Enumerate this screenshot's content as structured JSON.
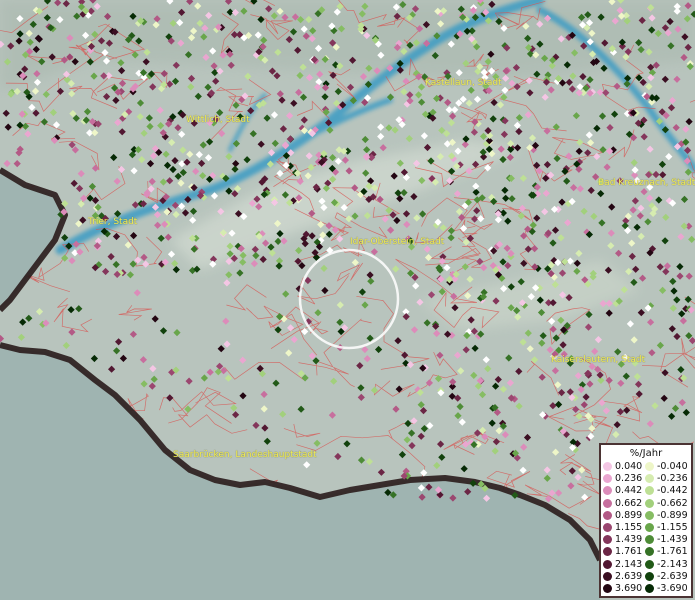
{
  "map": {
    "colors": {
      "background": "#b8c4bd",
      "outside_region": "#9fb4b1",
      "border_line": "#2a1c1c",
      "admin_lines": "#d9524f",
      "river": "#3a9bc4",
      "ridge": "#cfd8cf",
      "highlight_circle": "#ffffff"
    },
    "cities": [
      {
        "id": "kastellaun",
        "label": "Kastellaun, Stadt"
      },
      {
        "id": "wittlich",
        "label": "Wittlich, Stadt"
      },
      {
        "id": "bad-kreuznach",
        "label": "Bad Kreuznach, Stadt"
      },
      {
        "id": "trier",
        "label": "Trier, Stadt"
      },
      {
        "id": "idar-oberstein",
        "label": "Idar-Oberstein, Stadt"
      },
      {
        "id": "kaiserslautern",
        "label": "Kaiserslautern, Stadt"
      },
      {
        "id": "saarbruecken",
        "label": "Saarbrücken, Landeshauptstadt"
      }
    ]
  },
  "legend": {
    "title": "%/Jahr",
    "positive": [
      {
        "label": "0.040",
        "color": "#f4c6e4"
      },
      {
        "label": "0.236",
        "color": "#eaa6d0"
      },
      {
        "label": "0.442",
        "color": "#dc8cba"
      },
      {
        "label": "0.662",
        "color": "#c76f9e"
      },
      {
        "label": "0.899",
        "color": "#b35a86"
      },
      {
        "label": "1.155",
        "color": "#9b4770"
      },
      {
        "label": "1.439",
        "color": "#84365b"
      },
      {
        "label": "1.761",
        "color": "#6b2645"
      },
      {
        "label": "2.143",
        "color": "#521832"
      },
      {
        "label": "2.639",
        "color": "#3b0f22"
      },
      {
        "label": "3.690",
        "color": "#230612"
      }
    ],
    "negative": [
      {
        "label": "-0.040",
        "color": "#eef6c8"
      },
      {
        "label": "-0.236",
        "color": "#d6ecb0"
      },
      {
        "label": "-0.442",
        "color": "#bee095"
      },
      {
        "label": "-0.662",
        "color": "#a2d07c"
      },
      {
        "label": "-0.899",
        "color": "#86bd63"
      },
      {
        "label": "-1.155",
        "color": "#69a64b"
      },
      {
        "label": "-1.439",
        "color": "#4e8c37"
      },
      {
        "label": "-1.761",
        "color": "#367226"
      },
      {
        "label": "-2.143",
        "color": "#225a18"
      },
      {
        "label": "-2.639",
        "color": "#12420d"
      },
      {
        "label": "-3.690",
        "color": "#062a05"
      }
    ]
  }
}
